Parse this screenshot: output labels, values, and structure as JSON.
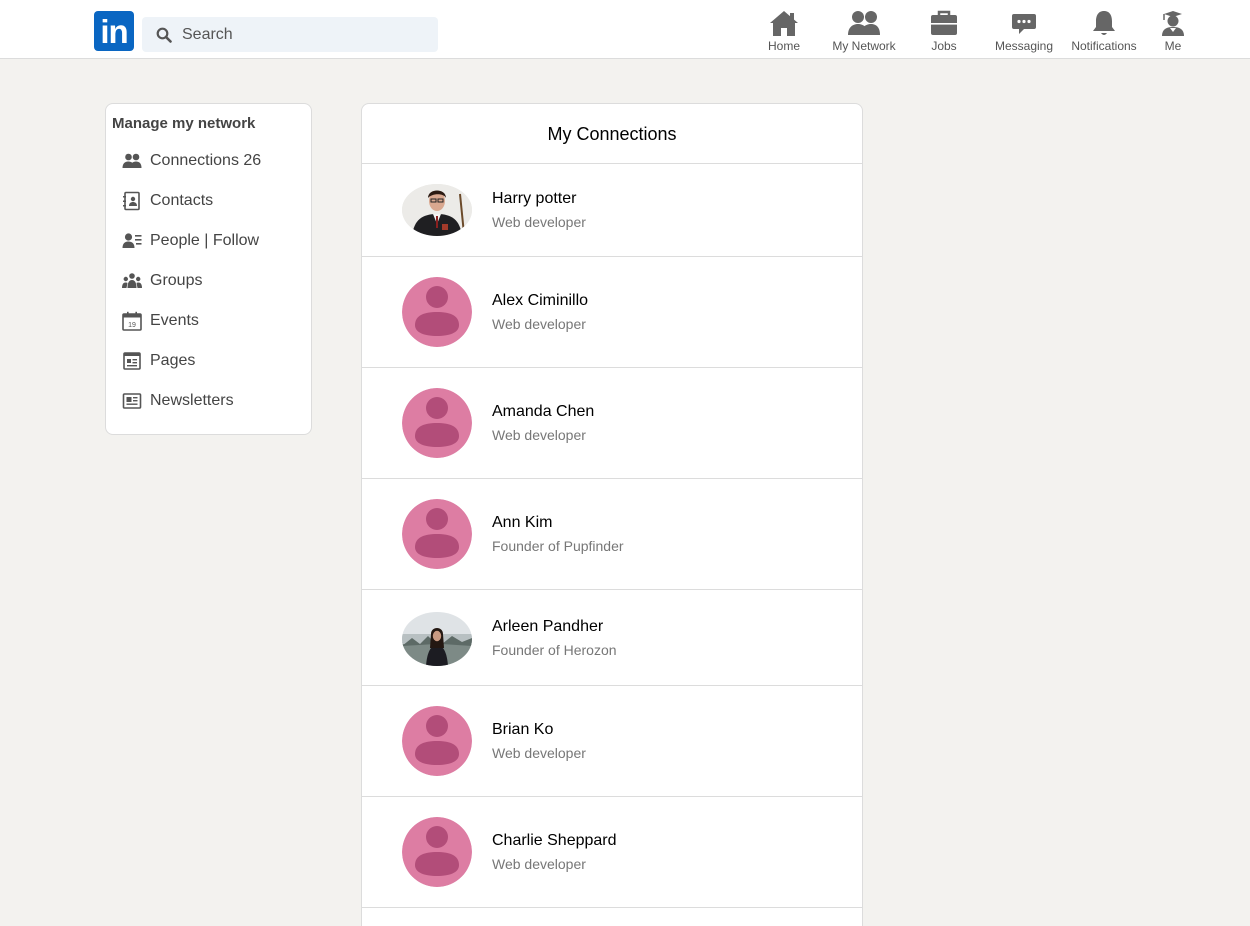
{
  "header": {
    "logo_text": "in",
    "search": {
      "placeholder": "Search",
      "value": ""
    },
    "nav": [
      {
        "label": "Home",
        "icon": "home-icon"
      },
      {
        "label": "My Network",
        "icon": "people-icon"
      },
      {
        "label": "Jobs",
        "icon": "briefcase-icon"
      },
      {
        "label": "Messaging",
        "icon": "message-icon"
      },
      {
        "label": "Notifications",
        "icon": "bell-icon"
      },
      {
        "label": "Me",
        "icon": "user-icon"
      }
    ]
  },
  "sidebar": {
    "title": "Manage my network",
    "items": [
      {
        "label": "Connections 26",
        "icon": "people-icon"
      },
      {
        "label": "Contacts",
        "icon": "contact-book-icon"
      },
      {
        "label": "People | Follow",
        "icon": "person-follow-icon"
      },
      {
        "label": "Groups",
        "icon": "groups-icon"
      },
      {
        "label": "Events",
        "icon": "calendar-icon",
        "icon_text": "19"
      },
      {
        "label": "Pages",
        "icon": "page-icon"
      },
      {
        "label": "Newsletters",
        "icon": "newsletter-icon"
      }
    ]
  },
  "connections": {
    "title": "My Connections",
    "items": [
      {
        "name": "Harry potter",
        "title": "Web developer",
        "avatar": "photo"
      },
      {
        "name": "Alex Ciminillo",
        "title": "Web developer",
        "avatar": "default"
      },
      {
        "name": "Amanda Chen",
        "title": "Web developer",
        "avatar": "default"
      },
      {
        "name": "Ann Kim",
        "title": "Founder of Pupfinder",
        "avatar": "default"
      },
      {
        "name": "Arleen Pandher",
        "title": "Founder of Herozon",
        "avatar": "photo"
      },
      {
        "name": "Brian Ko",
        "title": "Web developer",
        "avatar": "default"
      },
      {
        "name": "Charlie Sheppard",
        "title": "Web developer",
        "avatar": "default"
      }
    ]
  },
  "colors": {
    "brand": "#0a66c2",
    "avatar_bg": "#dd7da3",
    "avatar_fg": "#b24d79"
  }
}
